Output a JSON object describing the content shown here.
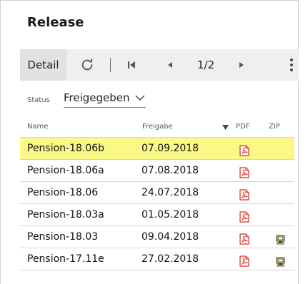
{
  "panel": {
    "title": "Release"
  },
  "toolbar": {
    "detail_label": "Detail",
    "page_indicator": "1/2"
  },
  "status": {
    "label": "Status",
    "value": "Freigegeben"
  },
  "table": {
    "headers": {
      "name": "Name",
      "release": "Freigabe",
      "pdf": "PDF",
      "zip": "ZIP"
    },
    "rows": [
      {
        "name": "Pension-18.06b",
        "date": "07.09.2018",
        "pdf": true,
        "zip": false,
        "selected": true
      },
      {
        "name": "Pension-18.06a",
        "date": "07.08.2018",
        "pdf": true,
        "zip": false,
        "selected": false
      },
      {
        "name": "Pension-18.06",
        "date": "24.07.2018",
        "pdf": true,
        "zip": false,
        "selected": false
      },
      {
        "name": "Pension-18.03a",
        "date": "01.05.2018",
        "pdf": true,
        "zip": false,
        "selected": false
      },
      {
        "name": "Pension-18.03",
        "date": "09.04.2018",
        "pdf": true,
        "zip": true,
        "selected": false
      },
      {
        "name": "Pension-17.11e",
        "date": "27.02.2018",
        "pdf": true,
        "zip": true,
        "selected": false
      }
    ]
  },
  "colors": {
    "selected_row": "#faf887",
    "toolbar_bg": "#efefef",
    "pdf_icon": "#d93025"
  },
  "icons": [
    "refresh-icon",
    "first-page-icon",
    "previous-page-icon",
    "next-page-icon",
    "more-vert-icon",
    "chevron-down-icon",
    "pdf-icon",
    "zip-icon",
    "sort-desc-icon"
  ]
}
